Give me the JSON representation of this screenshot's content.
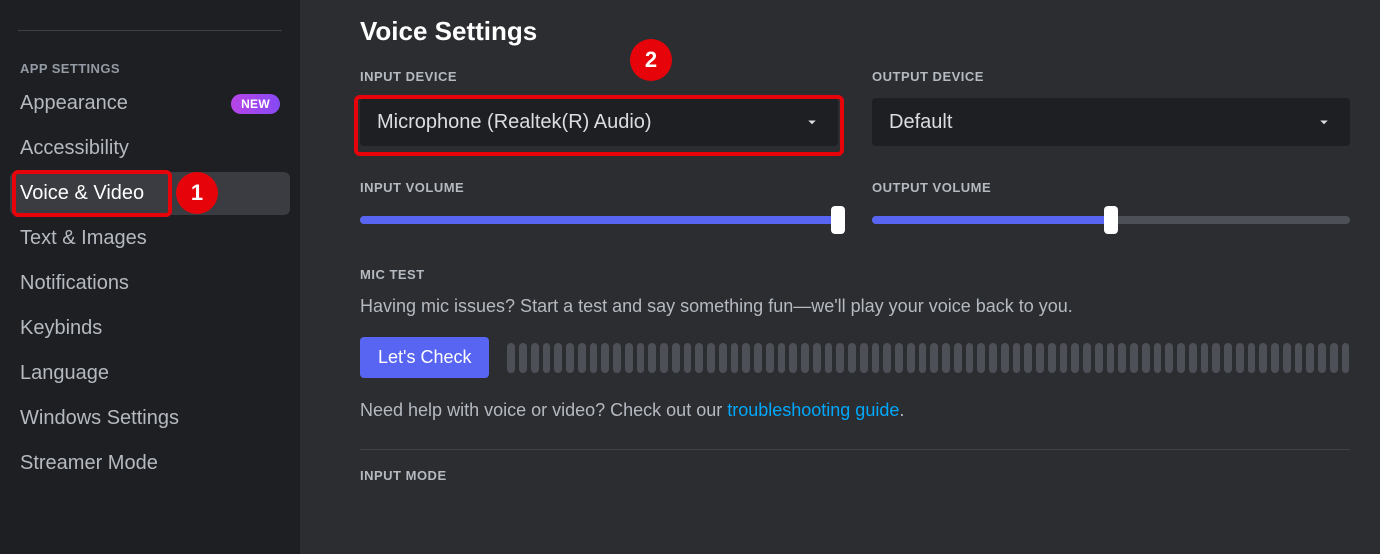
{
  "sidebar": {
    "section_title": "APP SETTINGS",
    "items": [
      {
        "label": "Appearance",
        "badge": "NEW"
      },
      {
        "label": "Accessibility"
      },
      {
        "label": "Voice & Video",
        "active": true,
        "marker": 1
      },
      {
        "label": "Text & Images"
      },
      {
        "label": "Notifications"
      },
      {
        "label": "Keybinds"
      },
      {
        "label": "Language"
      },
      {
        "label": "Windows Settings"
      },
      {
        "label": "Streamer Mode"
      }
    ]
  },
  "main": {
    "title": "Voice Settings",
    "input_device": {
      "label": "INPUT DEVICE",
      "value": "Microphone (Realtek(R) Audio)",
      "marker": 2
    },
    "output_device": {
      "label": "OUTPUT DEVICE",
      "value": "Default"
    },
    "input_volume": {
      "label": "INPUT VOLUME",
      "percent": 100
    },
    "output_volume": {
      "label": "OUTPUT VOLUME",
      "percent": 50
    },
    "mic_test": {
      "label": "MIC TEST",
      "description": "Having mic issues? Start a test and say something fun—we'll play your voice back to you.",
      "button": "Let's Check"
    },
    "help": {
      "prefix": "Need help with voice or video? Check out our ",
      "link_text": "troubleshooting guide",
      "suffix": "."
    },
    "input_mode_label": "INPUT MODE"
  },
  "annotations": {
    "badge_1": "1",
    "badge_2": "2"
  }
}
